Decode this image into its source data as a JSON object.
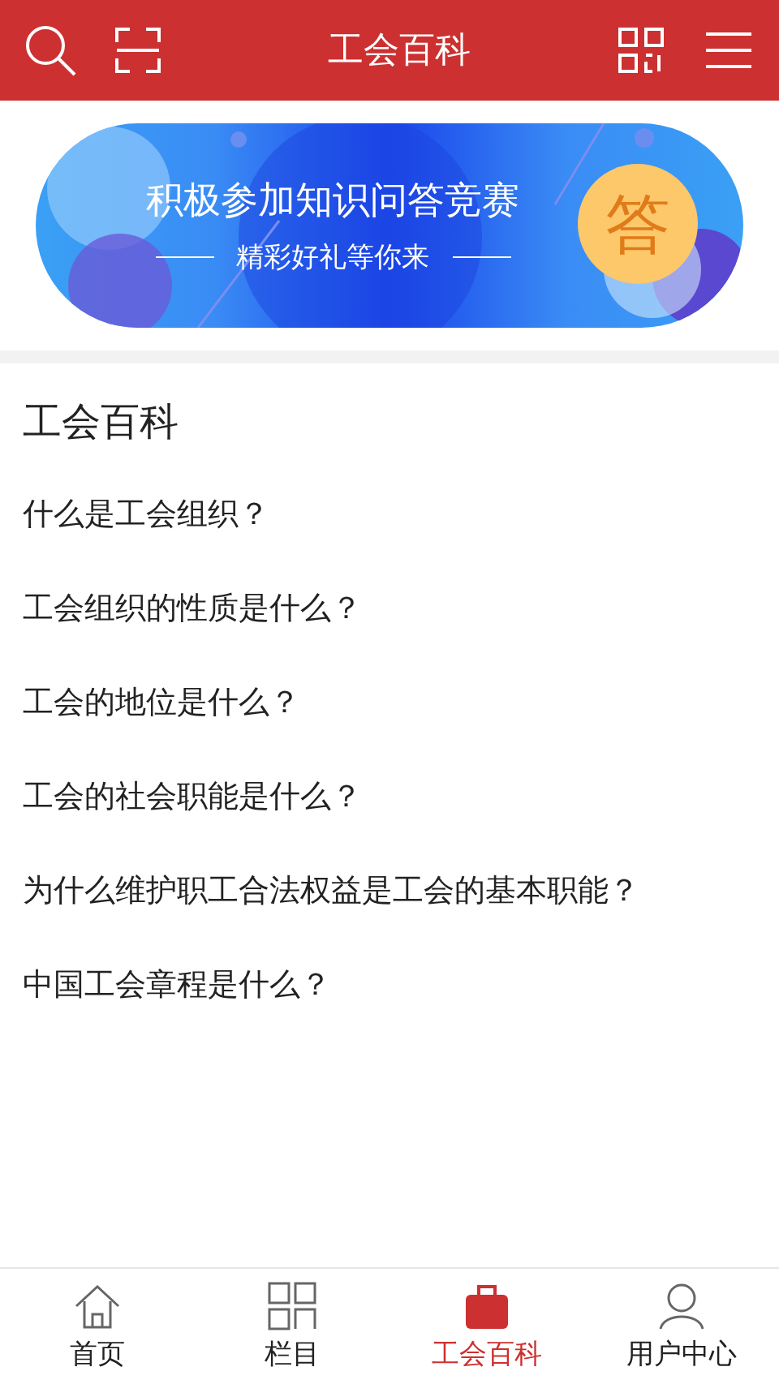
{
  "header": {
    "title": "工会百科"
  },
  "banner": {
    "headline": "积极参加知识问答竞赛",
    "tagline": "精彩好礼等你来",
    "badge": "答"
  },
  "section": {
    "title": "工会百科",
    "items": [
      "什么是工会组织？",
      "工会组织的性质是什么？",
      "工会的地位是什么？",
      "工会的社会职能是什么？",
      "为什么维护职工合法权益是工会的基本职能？",
      "中国工会章程是什么？"
    ]
  },
  "tabs": [
    {
      "label": "首页",
      "kind": "home",
      "selected": false
    },
    {
      "label": "栏目",
      "kind": "grid",
      "selected": false
    },
    {
      "label": "工会百科",
      "kind": "bag",
      "selected": true
    },
    {
      "label": "用户中心",
      "kind": "user",
      "selected": false
    }
  ]
}
